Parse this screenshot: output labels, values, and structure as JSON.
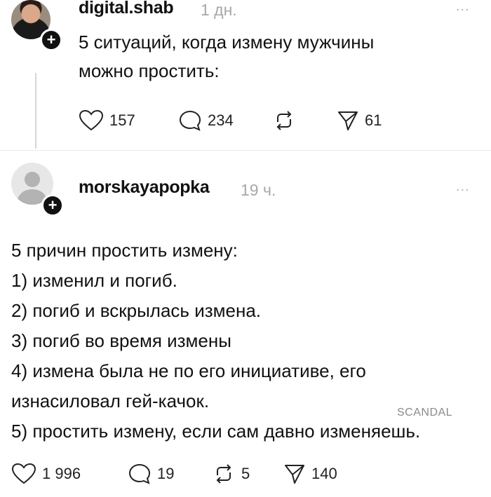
{
  "post1": {
    "username": "digital.shab",
    "time": "1 дн.",
    "menu": "...",
    "text_lines": [
      "5 ситуаций, когда измену мужчины",
      "можно простить:"
    ],
    "likes": "157",
    "comments": "234",
    "shares": "61"
  },
  "post2": {
    "username": "morskayapopka",
    "time": "19 ч.",
    "menu": "...",
    "lines": [
      "5 причин простить измену:",
      "1) изменил и погиб.",
      "2) погиб и вскрылась измена.",
      "3) погиб во время измены",
      "4) измена была не по его инициативе, его",
      "изнасиловал гей-качок.",
      "5) простить измену, если сам давно изменяешь."
    ],
    "likes": "1 996",
    "comments": "19",
    "reposts": "5",
    "shares": "140"
  },
  "watermark": "SCANDAL",
  "badge": "+",
  "icons": {
    "like": "heart-icon",
    "comment": "speech-bubble-icon",
    "repost": "repost-arrows-icon",
    "share": "paper-plane-icon"
  }
}
